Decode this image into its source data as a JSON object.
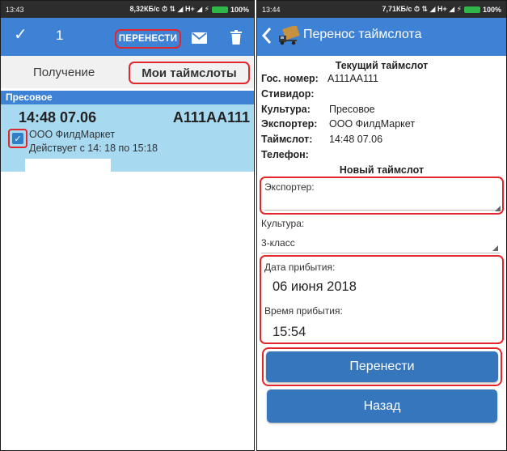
{
  "left_screen": {
    "status": {
      "time": "13:43",
      "indicators": "8,32КБ/с ⏱ ⇅ ◢ H+ ◢ ⚡",
      "battery": "100%"
    },
    "appbar": {
      "selected_count": "1",
      "move_label": "ПЕРЕНЕСТИ",
      "icons": [
        "check-icon",
        "mail-icon",
        "trash-icon"
      ]
    },
    "tabs": {
      "receive": "Получение",
      "mine": "Мои таймслоты"
    },
    "group_header": "Пресовое",
    "slot": {
      "time": "14:48 07.06",
      "plate": "А111АА111",
      "company": "ООО ФилдМаркет",
      "valid": "Действует с 14: 18 по 15:18",
      "checked": true
    }
  },
  "right_screen": {
    "status": {
      "time": "13:44",
      "indicators": "7,71КБ/с ⏱ ⇅ ◢ H+ ◢ ⚡",
      "battery": "100%"
    },
    "title": "Перенос таймслота",
    "current": {
      "title": "Текущий таймслот",
      "rows": [
        {
          "label": "Гос. номер:",
          "value": "А111АА111"
        },
        {
          "label": "Стивидор:",
          "value": ""
        },
        {
          "label": "Культура:",
          "value": "Пресовое"
        },
        {
          "label": "Экспортер:",
          "value": "ООО ФилдМаркет"
        },
        {
          "label": "Таймслот:",
          "value": "14:48 07.06"
        },
        {
          "label": "Телефон:",
          "value": ""
        }
      ]
    },
    "new": {
      "title": "Новый таймслот",
      "exporter_label": "Экспортер:",
      "culture_label": "Культура:",
      "culture_value": "3-класс",
      "date_label": "Дата прибытия:",
      "date_value": "06 июня 2018",
      "time_label": "Время прибытия:",
      "time_value": "15:54"
    },
    "buttons": {
      "move": "Перенести",
      "back": "Назад"
    }
  },
  "colors": {
    "appbar": "#3e82d5",
    "highlight": "#e3262b",
    "card": "#a7d9f0",
    "button": "#3576bd",
    "statusbar": "#2d2d2d"
  }
}
